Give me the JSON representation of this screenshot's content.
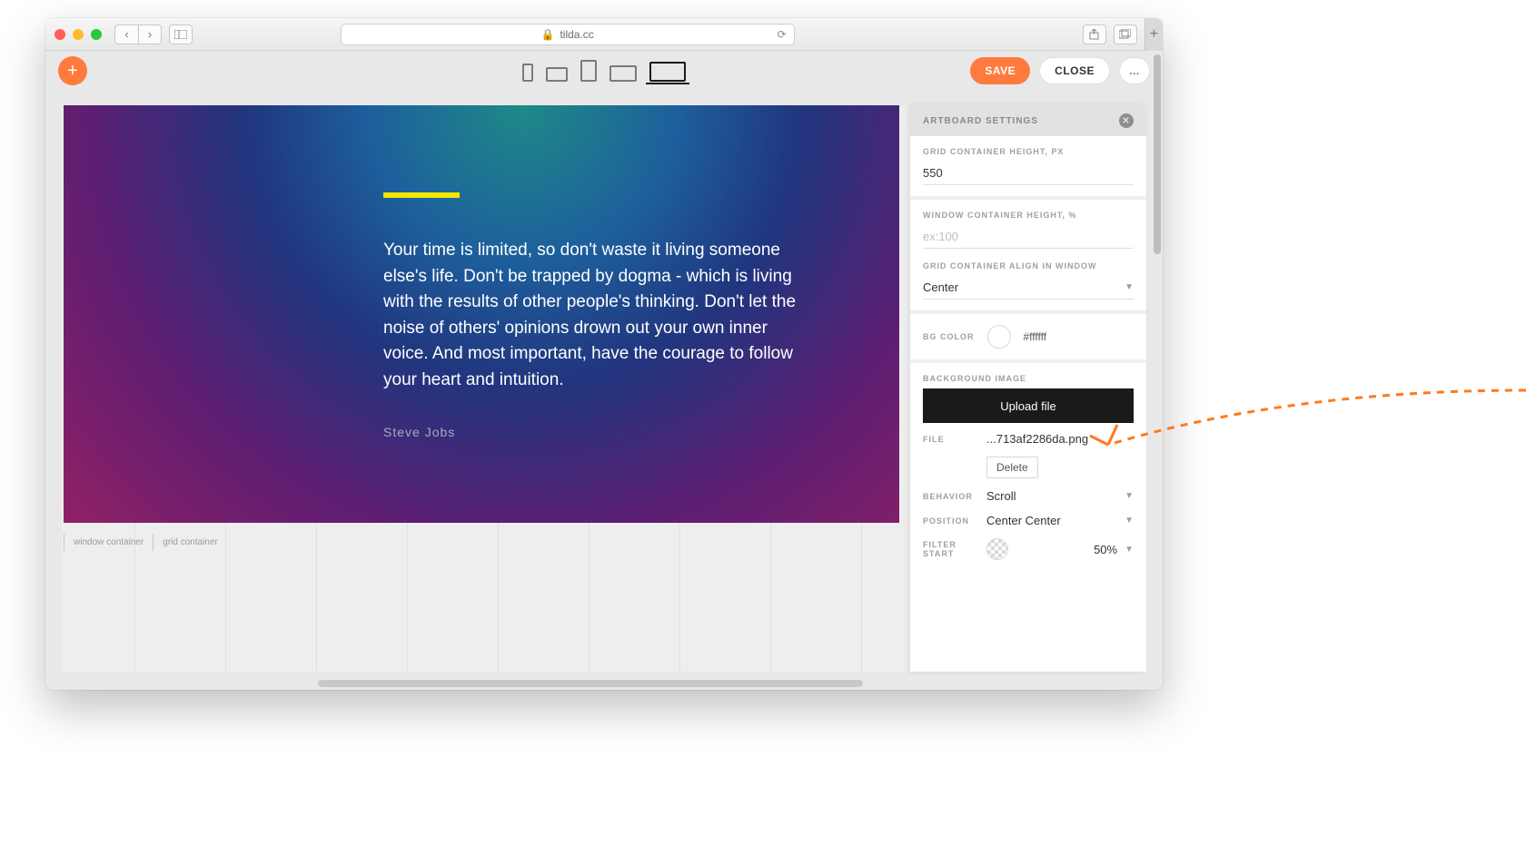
{
  "browser": {
    "url_host": "tilda.cc",
    "lock": "🔒",
    "reload": "⟳"
  },
  "app_top": {
    "save": "SAVE",
    "close": "CLOSE",
    "more": "..."
  },
  "artboard": {
    "quote": "Your time is limited, so don't waste it living someone else's life. Don't be trapped by dogma - which is living with the results of other people's thinking. Don't let the noise of others' opinions drown out your own inner voice. And most important, have the courage to follow your heart and intuition.",
    "author": "Steve Jobs",
    "label_window": "window container",
    "label_grid": "grid container"
  },
  "panel": {
    "title": "ARTBOARD SETTINGS",
    "grid_height_label": "GRID CONTAINER HEIGHT, PX",
    "grid_height_value": "550",
    "window_height_label": "WINDOW CONTAINER HEIGHT, %",
    "window_height_placeholder": "ex:100",
    "align_label": "GRID CONTAINER ALIGN IN WINDOW",
    "align_value": "Center",
    "bgcolor_label": "BG COLOR",
    "bgcolor_value": "#ffffff",
    "bgimage_label": "BACKGROUND IMAGE",
    "upload_label": "Upload file",
    "file_label": "FILE",
    "file_value": "...713af2286da.png",
    "delete_label": "Delete",
    "behavior_label": "BEHAVIOR",
    "behavior_value": "Scroll",
    "position_label": "POSITION",
    "position_value": "Center Center",
    "filter_start_label": "FILTER START",
    "filter_start_value": "50%"
  }
}
